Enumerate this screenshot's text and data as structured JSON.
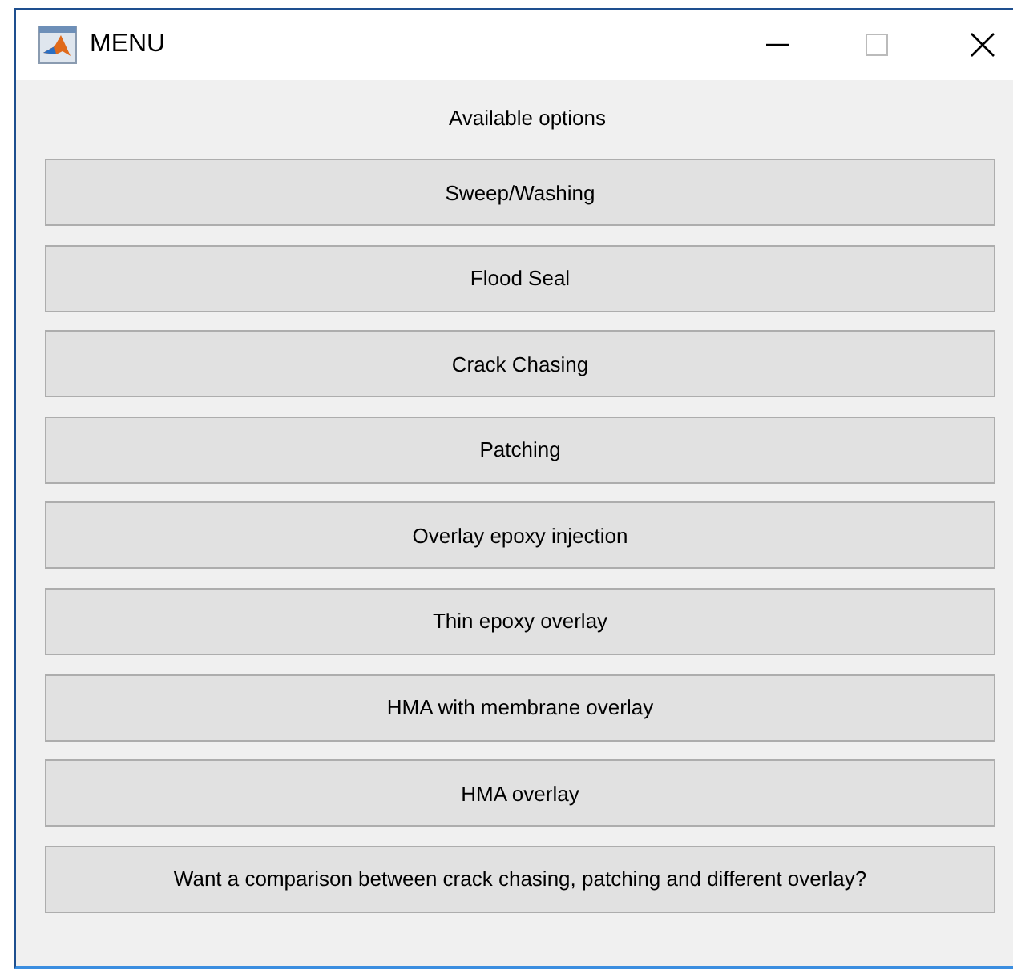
{
  "window": {
    "title": "MENU"
  },
  "heading": "Available options",
  "buttons": [
    {
      "label": "Sweep/Washing"
    },
    {
      "label": "Flood Seal"
    },
    {
      "label": "Crack Chasing"
    },
    {
      "label": "Patching"
    },
    {
      "label": "Overlay epoxy injection"
    },
    {
      "label": "Thin epoxy overlay"
    },
    {
      "label": "HMA with membrane overlay"
    },
    {
      "label": "HMA overlay"
    },
    {
      "label": "Want a comparison between crack chasing, patching and different overlay?"
    }
  ]
}
